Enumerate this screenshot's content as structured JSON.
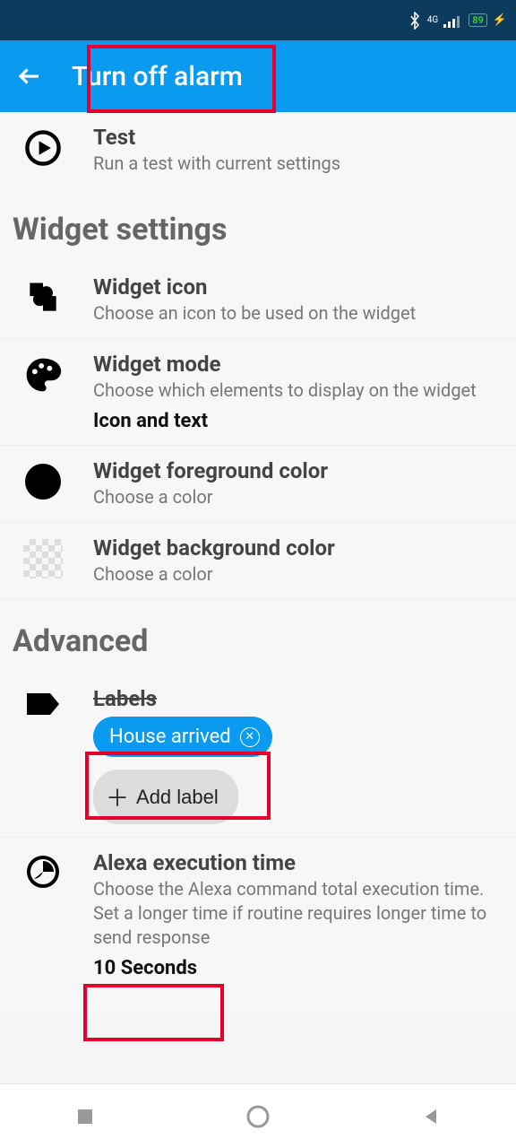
{
  "status": {
    "network": "4G",
    "battery": "89"
  },
  "appbar": {
    "title": "Turn off alarm"
  },
  "test": {
    "title": "Test",
    "sub": "Run a test with current settings"
  },
  "sections": {
    "widget": "Widget settings",
    "advanced": "Advanced"
  },
  "widget_icon": {
    "title": "Widget icon",
    "sub": "Choose an icon to be used on the widget"
  },
  "widget_mode": {
    "title": "Widget mode",
    "sub": "Choose which elements to display on the widget",
    "value": "Icon and text"
  },
  "widget_fg": {
    "title": "Widget foreground color",
    "sub": "Choose a color"
  },
  "widget_bg": {
    "title": "Widget background color",
    "sub": "Choose a color"
  },
  "labels": {
    "title": "Labels",
    "chip": "House arrived",
    "add": "Add label"
  },
  "alexa": {
    "title": "Alexa execution time",
    "sub": "Choose the Alexa command total execution time. Set a longer time if routine requires longer time to send response",
    "value": "10 Seconds"
  }
}
